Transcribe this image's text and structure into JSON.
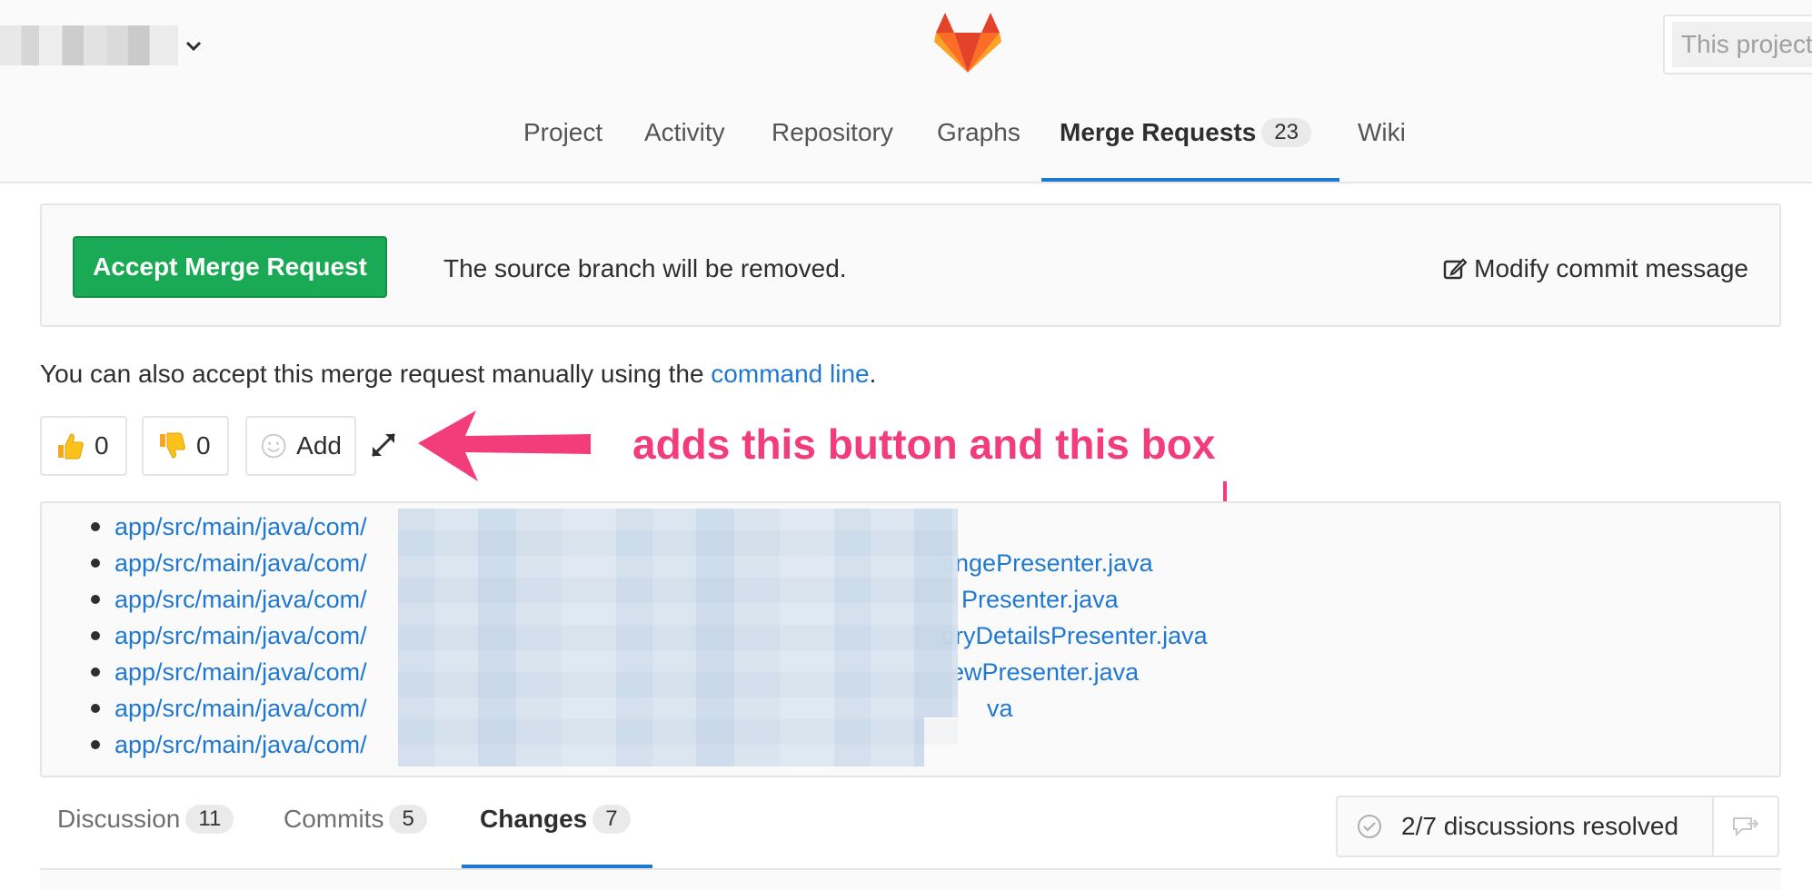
{
  "header": {
    "search_placeholder": "This project"
  },
  "nav": {
    "items": [
      {
        "label": "Project"
      },
      {
        "label": "Activity"
      },
      {
        "label": "Repository"
      },
      {
        "label": "Graphs"
      },
      {
        "label": "Merge Requests",
        "count": "23",
        "active": true
      },
      {
        "label": "Wiki"
      }
    ]
  },
  "merge": {
    "accept_label": "Accept Merge Request",
    "source_text": "The source branch will be removed.",
    "modify_label": "Modify commit message",
    "manual_prefix": "You can also accept this merge request manually using the ",
    "manual_link": "command line",
    "manual_suffix": "."
  },
  "awards": {
    "thumbs_up_count": "0",
    "thumbs_down_count": "0",
    "add_label": "Add"
  },
  "annotation": {
    "text": "adds this button and this box"
  },
  "files": {
    "items": [
      {
        "prefix": "app/src/main/java/com/",
        "suffix": ""
      },
      {
        "prefix": "app/src/main/java/com/",
        "suffix": "angePresenter.java"
      },
      {
        "prefix": "app/src/main/java/com/",
        "suffix": "Presenter.java"
      },
      {
        "prefix": "app/src/main/java/com/",
        "suffix": "oryDetailsPresenter.java"
      },
      {
        "prefix": "app/src/main/java/com/",
        "suffix": "ewPresenter.java"
      },
      {
        "prefix": "app/src/main/java/com/",
        "suffix": "va"
      },
      {
        "prefix": "app/src/main/java/com/",
        "suffix": ""
      }
    ]
  },
  "tabs": {
    "discussion_label": "Discussion",
    "discussion_count": "11",
    "commits_label": "Commits",
    "commits_count": "5",
    "changes_label": "Changes",
    "changes_count": "7"
  },
  "resolved": {
    "text": "2/7 discussions resolved"
  },
  "colors": {
    "accent": "#1f78d1",
    "success": "#1aaa55",
    "annotation": "#f33c7a"
  }
}
